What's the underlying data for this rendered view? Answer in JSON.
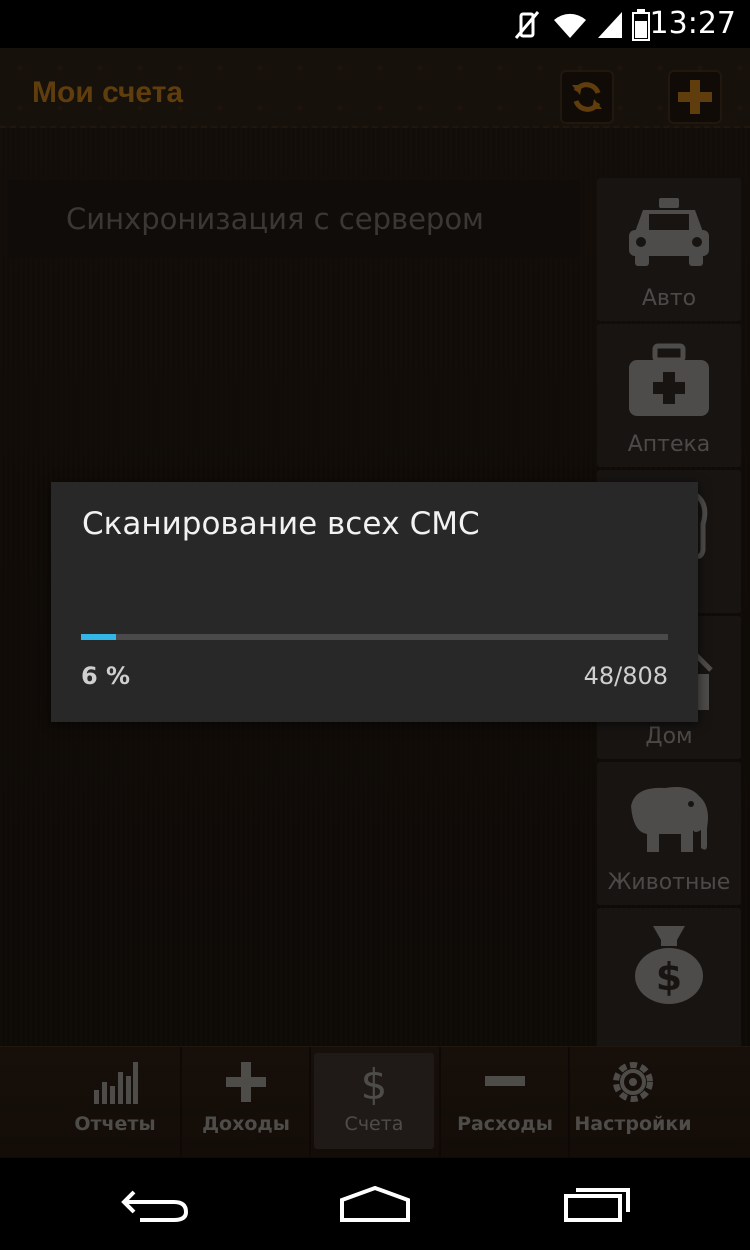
{
  "status_bar": {
    "time": "13:27"
  },
  "action_bar": {
    "title": "Мои счета"
  },
  "sync_banner": {
    "text": "Синхронизация с сервером"
  },
  "categories": [
    {
      "label": "Авто",
      "icon": "car-icon"
    },
    {
      "label": "Аптека",
      "icon": "medkit-icon"
    },
    {
      "label": "",
      "icon": "fuel-icon"
    },
    {
      "label": "Дом",
      "icon": "house-icon"
    },
    {
      "label": "Животные",
      "icon": "elephant-icon"
    },
    {
      "label": "",
      "icon": "money-bag-icon"
    }
  ],
  "tabs": [
    {
      "label": "Отчеты",
      "icon": "bar-chart-icon"
    },
    {
      "label": "Доходы",
      "icon": "plus-icon"
    },
    {
      "label": "Счета",
      "icon": "dollar-icon",
      "active": true
    },
    {
      "label": "Расходы",
      "icon": "minus-icon"
    },
    {
      "label": "Настройки",
      "icon": "gear-icon"
    }
  ],
  "dialog": {
    "title": "Сканирование всех СМС",
    "progress_percent_label": "6 %",
    "progress_count_label": "48/808",
    "progress_fraction": 0.06
  },
  "colors": {
    "accent": "#b06f17",
    "progress": "#33b5e5"
  }
}
